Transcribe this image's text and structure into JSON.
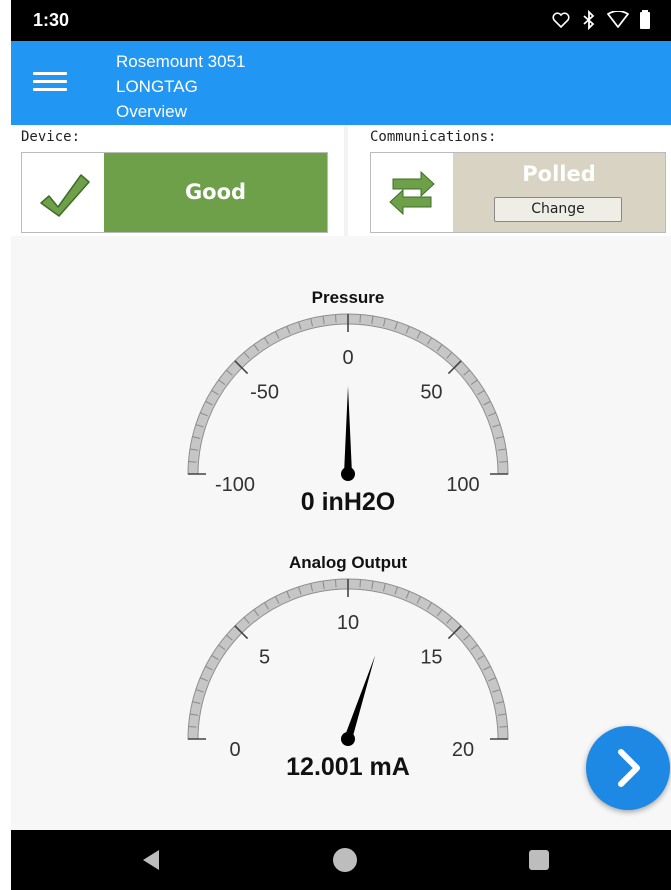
{
  "status_bar": {
    "time": "1:30",
    "icons": [
      "heart-outline-icon",
      "bluetooth-icon",
      "wifi-icon",
      "battery-icon"
    ]
  },
  "app_bar": {
    "line1": "Rosemount 3051",
    "line2": "LONGTAG",
    "line3": "Overview",
    "menu_icon": "hamburger-menu-icon"
  },
  "device": {
    "label": "Device:",
    "status": "Good",
    "status_color": "#6ea04a",
    "icon": "checkmark-icon"
  },
  "communications": {
    "label": "Communications:",
    "status": "Polled",
    "status_color": "#d9d3c3",
    "button": "Change",
    "icon": "sync-arrows-icon"
  },
  "gauges": [
    {
      "title": "Pressure",
      "min": -100,
      "max": 100,
      "value": 0,
      "ticks": [
        "-100",
        "-50",
        "0",
        "50",
        "100"
      ],
      "readout": "0 inH2O"
    },
    {
      "title": "Analog Output",
      "min": 0,
      "max": 20,
      "value": 12.001,
      "ticks": [
        "0",
        "5",
        "10",
        "15",
        "20"
      ],
      "readout": "12.001 mA"
    }
  ],
  "fab_icon": "chevron-right-icon",
  "nav_bar": {
    "icons": [
      "back-icon",
      "home-icon",
      "recents-icon"
    ]
  },
  "colors": {
    "app_bar": "#2196f3",
    "fab": "#1e88e5"
  }
}
